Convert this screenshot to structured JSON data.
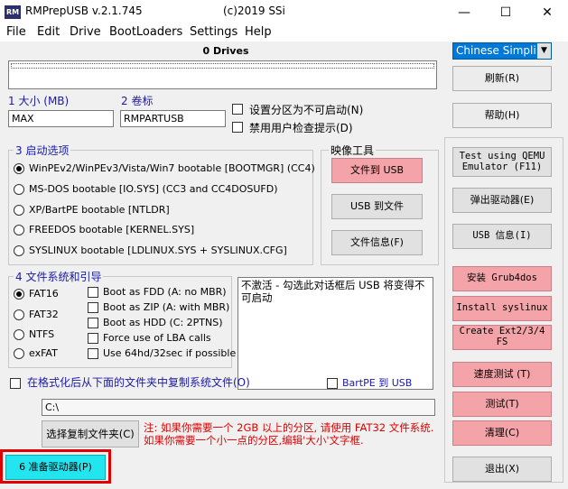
{
  "window": {
    "app_icon": "RM",
    "title": "RMPrepUSB v.2.1.745",
    "copyright": "(c)2019 SSi",
    "minimize": "—",
    "maximize": "☐",
    "close": "✕"
  },
  "menu": [
    "File",
    "Edit",
    "Drive",
    "BootLoaders",
    "Settings",
    "Help"
  ],
  "drives_header": "0 Drives",
  "language_select": "Chinese Simpli",
  "buttons_right": {
    "refresh": "刷新(R)",
    "help": "帮助(H)",
    "test_qemu": "Test using QEMU Emulator (F11)",
    "eject": "弹出驱动器(E)",
    "usb_info": "USB 信息(I)",
    "install_grub": "安装 Grub4dos",
    "install_syslinux": "Install syslinux",
    "create_ext": "Create Ext2/3/4 FS",
    "speed_test": "速度测试 (T)",
    "test": "测试(T)",
    "clean": "清理(C)",
    "exit": "退出(X)"
  },
  "size": {
    "label": "1 大小 (MB)",
    "value": "MAX"
  },
  "volume": {
    "label": "2 卷标",
    "value": "RMPARTUSB"
  },
  "checks_top": [
    "设置分区为不可启动(N)",
    "禁用用户检查提示(D)"
  ],
  "boot_options": {
    "title": "3 启动选项",
    "items": [
      "WinPEv2/WinPEv3/Vista/Win7 bootable [BOOTMGR] (CC4)",
      "MS-DOS bootable [IO.SYS]     (CC3 and CC4DOSUFD)",
      "XP/BartPE bootable [NTLDR]",
      "FREEDOS bootable [KERNEL.SYS]",
      "SYSLINUX bootable [LDLINUX.SYS + SYSLINUX.CFG]"
    ]
  },
  "image_tools": {
    "title": "映像工具",
    "to_usb": "文件到 USB",
    "usb_to_file": "USB 到文件",
    "file_info": "文件信息(F)"
  },
  "fs": {
    "title": "4 文件系统和引导",
    "radios": [
      "FAT16",
      "FAT32",
      "NTFS",
      "exFAT"
    ],
    "checks": [
      "Boot as FDD (A: no MBR)",
      "Boot as ZIP (A: with MBR)",
      "Boot as HDD (C: 2PTNS)",
      "Force use of LBA calls",
      "Use 64hd/32sec if possible"
    ]
  },
  "memo_text": "不激活 - 勾选此对话框后 USB 将变得不可启动",
  "copy_files_check": "在格式化后从下面的文件夹中复制系统文件(O)",
  "bartpe_check": "BartPE 到 USB",
  "path_value": "C:\\",
  "choose_folder_btn": "选择复制文件夹(C)",
  "note": "注: 如果你需要一个 2GB 以上的分区, 请使用 FAT32 文件系统. 如果你需要一个小一点的分区,编辑'大小'文字框.",
  "prepare_btn": "6 准备驱动器(P)"
}
